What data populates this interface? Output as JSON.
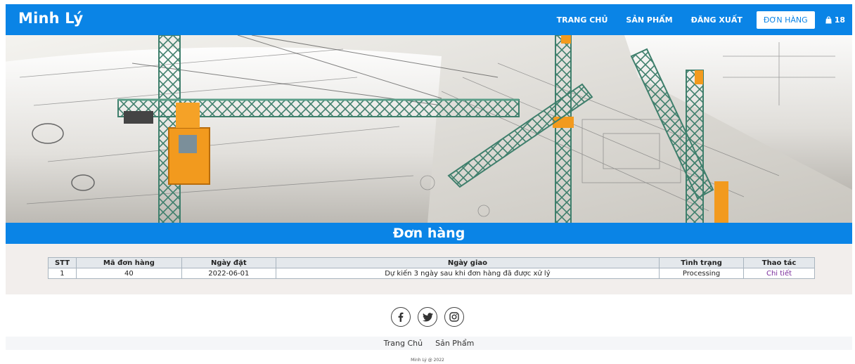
{
  "nav": {
    "brand": "Minh Lý",
    "links": [
      "TRANG CHỦ",
      "SẢN PHẨM",
      "ĐĂNG XUẤT"
    ],
    "active_link": "ĐƠN HÀNG",
    "cart_count": "18",
    "cart_icon": "shopping-bag-icon"
  },
  "page_title": "Đơn hàng",
  "orders": {
    "headers": [
      "STT",
      "Mã đơn hàng",
      "Ngày đặt",
      "Ngày giao",
      "Tình trạng",
      "Thao tác"
    ],
    "rows": [
      [
        "1",
        "40",
        "2022-06-01",
        "Dự kiến 3 ngày sau khi đơn hàng đã được xử lý",
        "Processing",
        "Chi tiết"
      ]
    ]
  },
  "footer": {
    "social_icons": [
      "facebook-icon",
      "twitter-icon",
      "instagram-icon"
    ],
    "links": [
      "Trang Chủ",
      "Sản Phẩm"
    ],
    "copyright": "Minh Lý @ 2022"
  },
  "colors": {
    "primary": "#0a84e6",
    "section_bg": "#f2eeec",
    "link_purple": "#7a2c9c"
  }
}
